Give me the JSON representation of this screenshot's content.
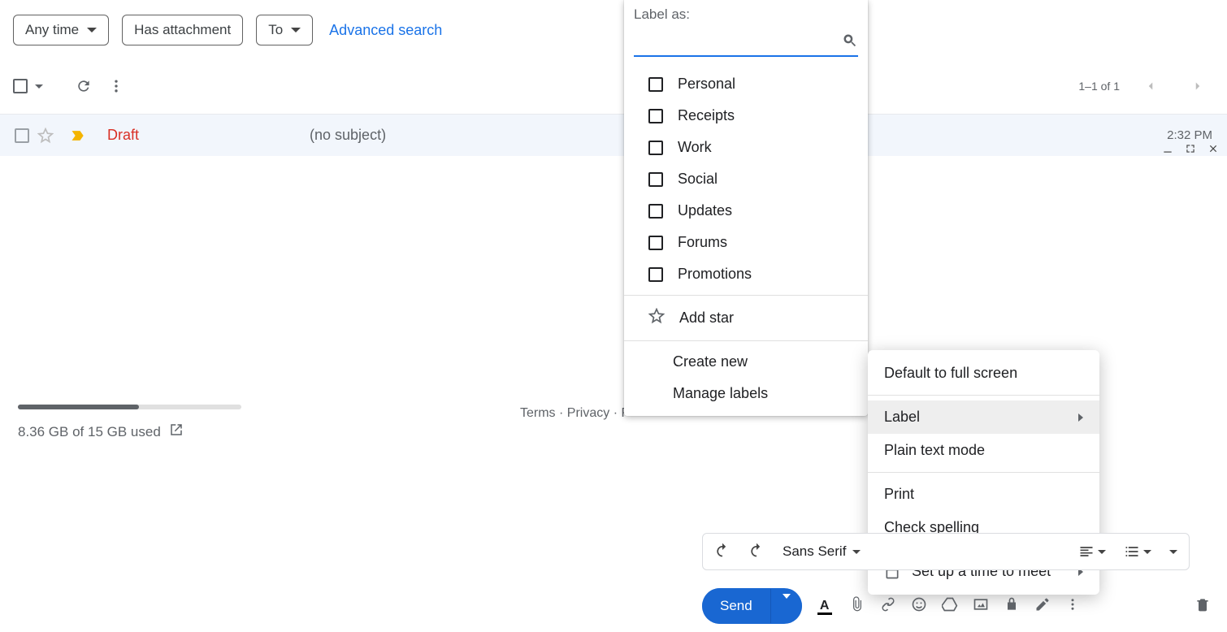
{
  "filters": {
    "anytime": "Any time",
    "attachment": "Has attachment",
    "to": "To",
    "advanced": "Advanced search"
  },
  "paging": {
    "text": "1–1 of 1"
  },
  "row": {
    "draft": "Draft",
    "subject": "(no subject)",
    "time": "2:32 PM"
  },
  "storage": {
    "text": "8.36 GB of 15 GB used"
  },
  "legal": {
    "terms": "Terms",
    "privacy": "Privacy",
    "pr": "P"
  },
  "label_popup": {
    "title": "Label as:",
    "search_placeholder": "",
    "labels": [
      "Personal",
      "Receipts",
      "Work",
      "Social",
      "Updates",
      "Forums",
      "Promotions"
    ],
    "add_star": "Add star",
    "create": "Create new",
    "manage": "Manage labels"
  },
  "options_menu": {
    "fullscreen": "Default to full screen",
    "label": "Label",
    "plain": "Plain text mode",
    "print": "Print",
    "spell": "Check spelling",
    "meet": "Set up a time to meet"
  },
  "format_bar": {
    "font": "Sans Serif"
  },
  "send": {
    "label": "Send"
  }
}
